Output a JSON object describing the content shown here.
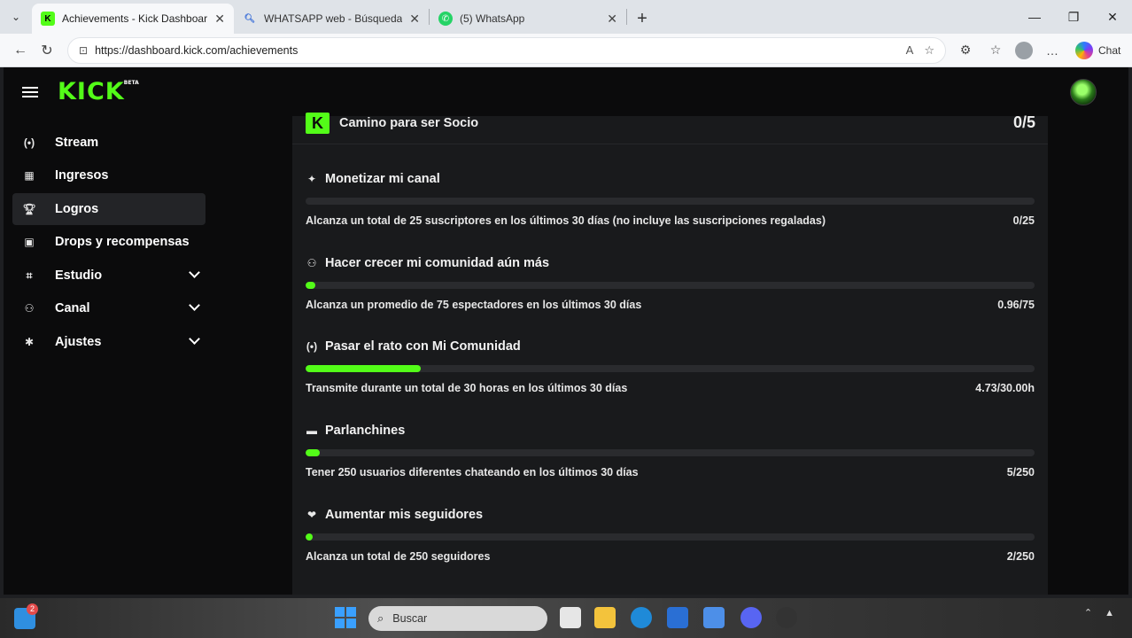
{
  "browser": {
    "tabs": [
      {
        "title": "Achievements - Kick Dashboard",
        "active": true,
        "favicon": "kick-icon"
      },
      {
        "title": "WHATSAPP web - Búsqueda",
        "active": false,
        "favicon": "search-icon"
      },
      {
        "title": "(5) WhatsApp",
        "active": false,
        "favicon": "whatsapp-icon"
      }
    ],
    "url": "https://dashboard.kick.com/achievements",
    "copilot_label": "Chat"
  },
  "app": {
    "logo": "KICK",
    "logo_badge": "BETA"
  },
  "sidebar": {
    "items": [
      {
        "label": "Stream",
        "icon": "broadcast-icon"
      },
      {
        "label": "Ingresos",
        "icon": "revenue-icon"
      },
      {
        "label": "Logros",
        "icon": "trophy-icon",
        "active": true
      },
      {
        "label": "Drops y recompensas",
        "icon": "gift-icon"
      },
      {
        "label": "Estudio",
        "icon": "studio-icon",
        "expandable": true
      },
      {
        "label": "Canal",
        "icon": "users-icon",
        "expandable": true
      },
      {
        "label": "Ajustes",
        "icon": "gear-icon",
        "expandable": true
      }
    ]
  },
  "partner": {
    "title": "Camino para ser Socio",
    "count": "0/5"
  },
  "achievements": [
    {
      "title": "Monetizar mi canal",
      "icon": "sparkle-icon",
      "description": "Alcanza un total de 25 suscriptores en los últimos 30 días (no incluye las suscripciones regaladas)",
      "value": "0/25",
      "progress": 0.0
    },
    {
      "title": "Hacer crecer mi comunidad aún más",
      "icon": "community-icon",
      "description": "Alcanza un promedio de 75 espectadores en los últimos 30 días",
      "value": "0.96/75",
      "progress": 0.0128
    },
    {
      "title": "Pasar el rato con Mi Comunidad",
      "icon": "broadcast-icon",
      "description": "Transmite durante un total de 30 horas en los últimos 30 días",
      "value": "4.73/30.00h",
      "progress": 0.1577
    },
    {
      "title": "Parlanchines",
      "icon": "chat-icon",
      "description": "Tener 250 usuarios diferentes chateando en los últimos 30 días",
      "value": "5/250",
      "progress": 0.02
    },
    {
      "title": "Aumentar mis seguidores",
      "icon": "heart-icon",
      "description": "Alcanza un total de 250 seguidores",
      "value": "2/250",
      "progress": 0.008
    }
  ],
  "taskbar": {
    "search_placeholder": "Buscar",
    "widget_badge": "2"
  },
  "colors": {
    "accent": "#53fc18",
    "background": "#0b0b0c",
    "panel": "#191a1c",
    "track": "#2a2b2e"
  }
}
